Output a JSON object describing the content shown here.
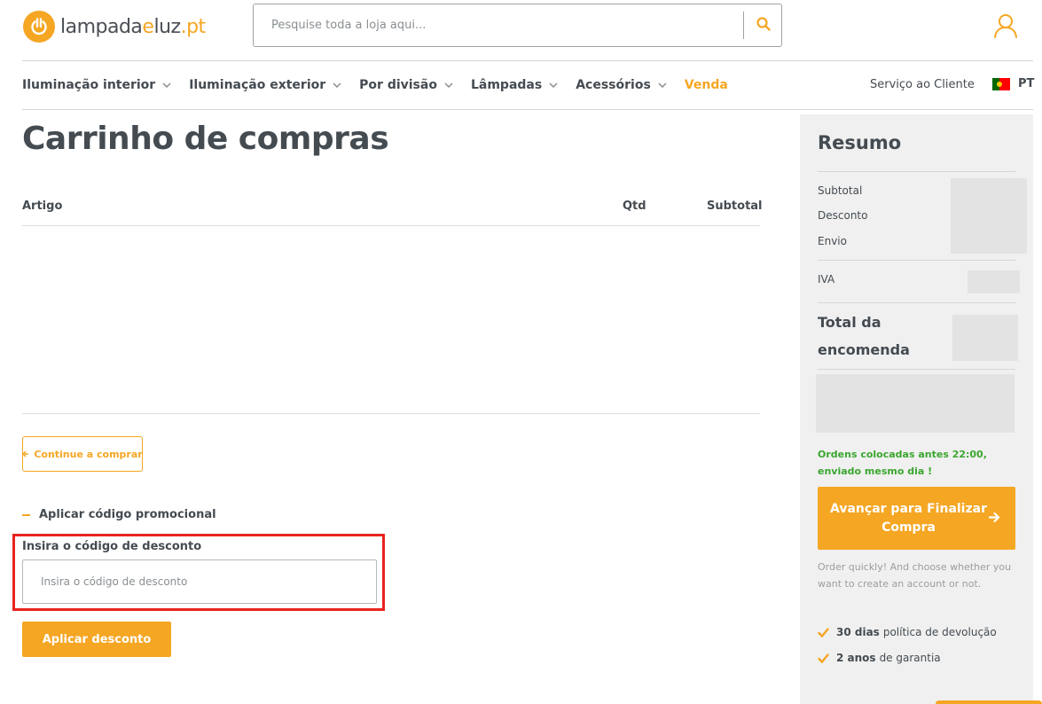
{
  "brand": {
    "logo_prefix": "lampada",
    "logo_mid": "e",
    "logo_luz": "luz",
    "logo_suffix": ".pt",
    "accent": "#f5a623"
  },
  "header": {
    "search_placeholder": "Pesquise toda a loja aqui...",
    "search_icon": "search-icon",
    "account_icon": "user-icon"
  },
  "nav": {
    "items": [
      {
        "label": "Iluminação interior"
      },
      {
        "label": "Iluminação exterior"
      },
      {
        "label": "Por divisão"
      },
      {
        "label": "Lâmpadas"
      },
      {
        "label": "Acessórios"
      },
      {
        "label": "Venda"
      }
    ],
    "service": "Serviço ao Cliente",
    "language": "PT"
  },
  "cart": {
    "title": "Carrinho de compras",
    "columns": {
      "item": "Artigo",
      "qty": "Qtd",
      "subtotal": "Subtotal"
    },
    "continue_label": "Continue a comprar"
  },
  "promo": {
    "toggle_label": "Aplicar código promocional",
    "field_label": "Insira o código de desconto",
    "placeholder": "Insira o código de desconto",
    "apply_label": "Aplicar desconto"
  },
  "summary": {
    "title": "Resumo",
    "subtotal_label": "Subtotal",
    "discount_label": "Desconto",
    "shipping_label": "Envio",
    "vat_label": "IVA",
    "total_label": "Total da encomenda",
    "shipping_note": "Ordens colocadas antes 22:00, enviado mesmo dia !",
    "checkout_label": "Avançar para Finalizar Compra",
    "checkout_hint": "Order quickly! And choose whether you want to create an account or not.",
    "perks": [
      {
        "bold": "30 dias",
        "text": "política de devolução"
      },
      {
        "bold": "2 anos",
        "text": "de garantia"
      }
    ]
  }
}
